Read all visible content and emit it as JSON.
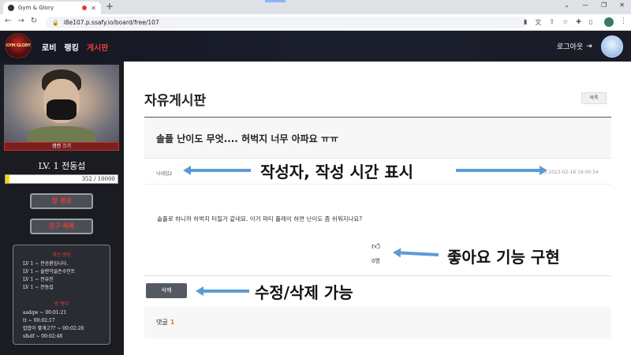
{
  "browser": {
    "tab_title": "Gym & Glory",
    "url": "i8e107.p.ssafy.io/board/free/107"
  },
  "header": {
    "logo_text": "GYM GLORY",
    "nav": [
      {
        "label": "로비"
      },
      {
        "label": "랭킹"
      },
      {
        "label": "게시판"
      }
    ],
    "logout_label": "로그아웃",
    "logout_icon": "logout-arrow-icon"
  },
  "sidebar": {
    "cam_label": "캠켄 끄기",
    "level_text": "LV. 1 전동섭",
    "xp": {
      "current": 352,
      "max": 10000,
      "text": "352 / 10000"
    },
    "room_button": "방 생성",
    "friends_button": "친구 목록",
    "personal_rank_title": "개인 랭킹",
    "personal_rank": [
      "LV 1 ~ 전승환입니다.",
      "LV 1 ~ 솔란악골손수민트",
      "LV 1 ~ 전유진",
      "LV 1 ~ 전동섭"
    ],
    "room_rank_title": "방 랭킹",
    "room_rank": [
      "asdqw ~ 00:01:21",
      "tt ~ 00:02:17",
      "밥밥이 몇개고?? ~ 00:02:28",
      "sfsdf ~ 00:02:48"
    ]
  },
  "board": {
    "title": "자유게시판",
    "list_button": "목록",
    "post_title": "솔플 난이도 무엇.... 허벅지 너무 아파요 ㅠㅠ",
    "author": "닉네임2",
    "date": "2023-02-16 16:00:54",
    "body": "솔플로 하니까 허벅지 터질거 같네요. 이거 파티 플레이 하면 난이도 좀 쉬워지나요?",
    "like_icon": "thumbs-up-icon",
    "like_count": "0명",
    "delete_button": "삭제",
    "comment_label": "댓글",
    "comment_count": "1"
  },
  "annotations": {
    "author_time": "작성자, 작성 시간 표시",
    "like": "좋아요 기능 구현",
    "edit_delete": "수정/삭제 가능",
    "arrow_color": "#5b9bd5"
  }
}
